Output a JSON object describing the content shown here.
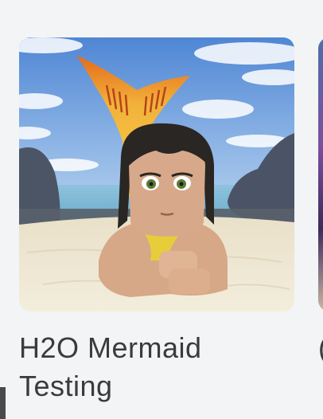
{
  "experience_card": {
    "title": "H2O Mermaid Testing",
    "thumbnail_icon": "mermaid-avatar-thumbnail"
  },
  "next_card": {
    "title_partial": "("
  },
  "colors": {
    "page_background": "#f2f4f5",
    "title_text": "#393b3d",
    "sky": "#5a8fd6",
    "sand": "#ece4cf",
    "tail": "#f0b93a"
  }
}
